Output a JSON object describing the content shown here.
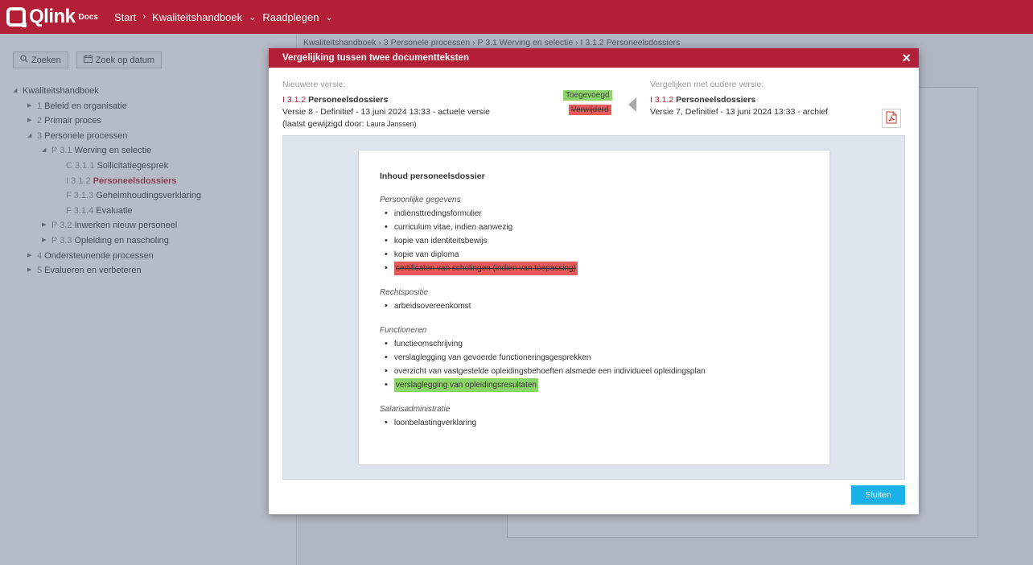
{
  "app": {
    "logo_text": "Qlink",
    "logo_sub": "Docs",
    "nav": [
      "Start",
      "Kwaliteitshandboek",
      "Raadplegen"
    ],
    "nav_sep": "›"
  },
  "sidebar": {
    "search_label": "Zoeken",
    "date_search_label": "Zoek op datum",
    "tree": [
      {
        "level": 0,
        "expanded": true,
        "num": "",
        "label": "Kwaliteitshandboek"
      },
      {
        "level": 1,
        "expanded": false,
        "num": "1",
        "label": "Beleid en organisatie"
      },
      {
        "level": 1,
        "expanded": false,
        "num": "2",
        "label": "Primair proces"
      },
      {
        "level": 1,
        "expanded": true,
        "num": "3",
        "label": "Personele processen"
      },
      {
        "level": 2,
        "expanded": true,
        "num": "P 3.1",
        "label": "Werving en selectie"
      },
      {
        "level": 3,
        "leaf": true,
        "num": "C 3.1.1",
        "label": "Sollicitatiegesprek"
      },
      {
        "level": 3,
        "leaf": true,
        "num": "I 3.1.2",
        "label": "Personeelsdossiers",
        "active": true
      },
      {
        "level": 3,
        "leaf": true,
        "num": "F 3.1.3",
        "label": "Geheimhoudingsverklaring"
      },
      {
        "level": 3,
        "leaf": true,
        "num": "F 3.1.4",
        "label": "Evaluatie"
      },
      {
        "level": 2,
        "expanded": false,
        "num": "P 3.2",
        "label": "Inwerken nieuw personeel"
      },
      {
        "level": 2,
        "expanded": false,
        "num": "P 3.3",
        "label": "Opleiding en nascholing"
      },
      {
        "level": 1,
        "expanded": false,
        "num": "4",
        "label": "Ondersteunende processen"
      },
      {
        "level": 1,
        "expanded": false,
        "num": "5",
        "label": "Evalueren en verbeteren"
      }
    ]
  },
  "breadcrumb": "Kwaliteitshandboek  ›  3 Personele processen  ›  P 3.1 Werving en selectie  ›  I 3.1.2 Personeelsdossiers",
  "modal": {
    "title": "Vergelijking tussen twee documentteksten",
    "close_icon": "×",
    "newer": {
      "label": "Nieuwere versie:",
      "doc_num": "I 3.1.2",
      "doc_title": "Personeelsdossiers",
      "version": "Versie 8 - Definitief - 13 juni 2024 13:33 - actuele versie",
      "modified_by_label": "(laatst gewijzigd door:",
      "modified_by": "Laura Janssen)"
    },
    "legend_added": "Toegevoegd",
    "legend_removed": "Verwijderd",
    "older": {
      "label": "Vergelijken met oudere versie:",
      "doc_num": "I 3.1.2",
      "doc_title": "Personeelsdossiers",
      "version": "Versie 7, Definitief - 13 juni 2024 13:33 - archief"
    },
    "close_button": "Sluiten",
    "colors": {
      "accent": "#b31f37",
      "added": "#8cd36a",
      "removed": "#e85a5a",
      "primary_button": "#1ab0e8"
    }
  },
  "document": {
    "heading": "Inhoud personeelsdossier",
    "sections": [
      {
        "title": "Persoonlijke gegevens",
        "items": [
          {
            "text": "indiensttredingsformulier",
            "status": "same"
          },
          {
            "text": "curriculum vitae, indien aanwezig",
            "status": "same"
          },
          {
            "text": "kopie van identiteitsbewijs",
            "status": "same"
          },
          {
            "text": "kopie van diploma",
            "status": "same"
          },
          {
            "text": "certificaten van scholingen (indien van toepassing)",
            "status": "removed"
          }
        ]
      },
      {
        "title": "Rechtspositie",
        "items": [
          {
            "text": "arbeidsovereenkomst",
            "status": "same"
          }
        ]
      },
      {
        "title": "Functioneren",
        "items": [
          {
            "text": "functieomschrijving",
            "status": "same"
          },
          {
            "text": "verslaglegging van gevoerde functioneringsgesprekken",
            "status": "same"
          },
          {
            "text": "overzicht van vastgestelde opleidingsbehoeften alsmede een individueel opleidingsplan",
            "status": "same"
          },
          {
            "text": "verslaglegging van opleidingsresultaten",
            "status": "added"
          }
        ]
      },
      {
        "title": "Salarisadministratie",
        "items": [
          {
            "text": "loonbelastingverklaring",
            "status": "same"
          }
        ]
      }
    ]
  }
}
